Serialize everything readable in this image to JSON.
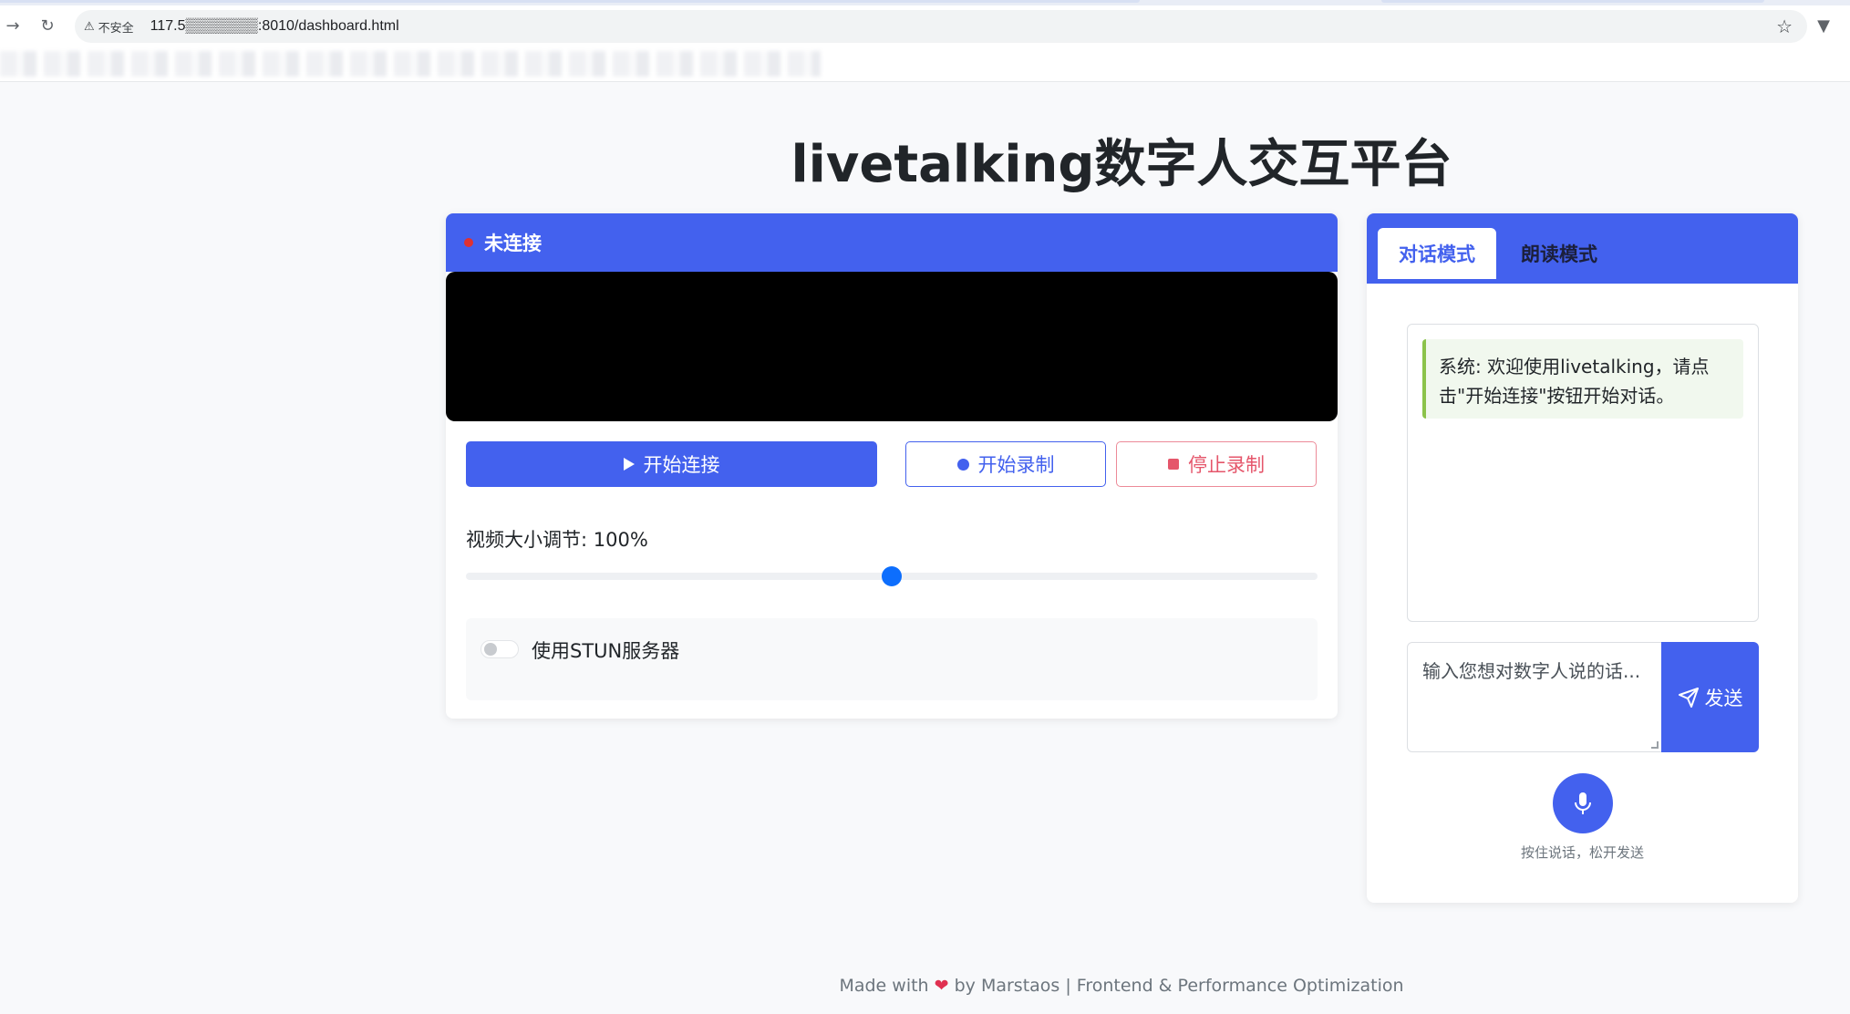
{
  "browser": {
    "security_label": "不安全",
    "url": "117.5▒▒▒▒▒▒▒:8010/dashboard.html"
  },
  "page": {
    "title": "livetalking数字人交互平台"
  },
  "video_panel": {
    "status": "未连接",
    "status_color": "#e03131",
    "buttons": {
      "start": "开始连接",
      "record": "开始录制",
      "stop": "停止录制"
    },
    "size_label": "视频大小调节: 100%",
    "size_value_percent": 100,
    "slider_fraction": 0.5,
    "stun_label": "使用STUN服务器",
    "stun_enabled": false
  },
  "chat_panel": {
    "tabs": [
      {
        "label": "对话模式",
        "active": true
      },
      {
        "label": "朗读模式",
        "active": false
      }
    ],
    "messages": [
      {
        "role": "system",
        "text": "系统: 欢迎使用livetalking，请点击\"开始连接\"按钮开始对话。"
      }
    ],
    "input_placeholder": "输入您想对数字人说的话...",
    "send_label": "发送",
    "mic_hint": "按住说话，松开发送"
  },
  "footer": {
    "made_with": "Made with",
    "heart": "❤",
    "by": "by Marstaos | Frontend & Performance Optimization"
  },
  "colors": {
    "primary": "#4361ee",
    "danger": "#e5566b",
    "slider": "#0d6efd"
  }
}
